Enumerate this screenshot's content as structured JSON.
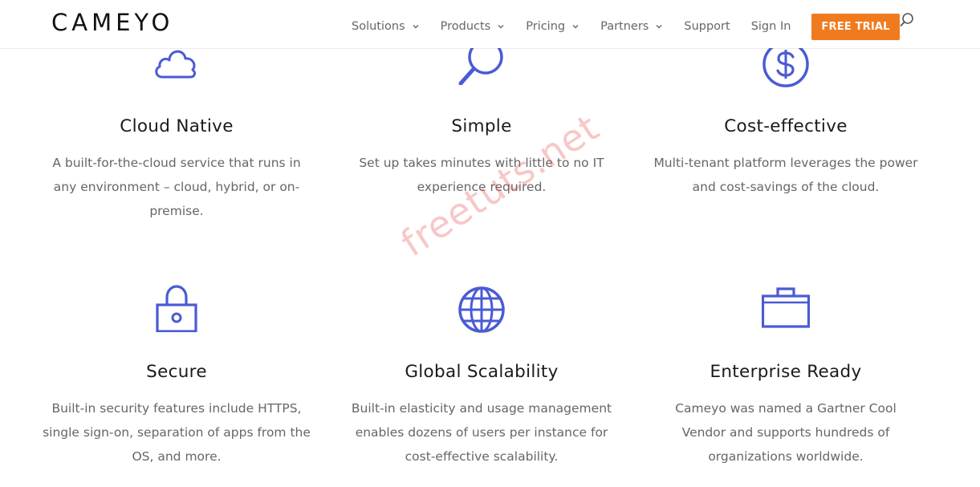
{
  "header": {
    "logo": "CAMEYO",
    "nav": [
      {
        "label": "Solutions",
        "has_dropdown": true
      },
      {
        "label": "Products",
        "has_dropdown": true
      },
      {
        "label": "Pricing",
        "has_dropdown": true
      },
      {
        "label": "Partners",
        "has_dropdown": true
      },
      {
        "label": "Support",
        "has_dropdown": false
      },
      {
        "label": "Sign In",
        "has_dropdown": false
      }
    ],
    "cta": "FREE TRIAL",
    "search_icon": "search-icon"
  },
  "features": [
    {
      "icon": "cloud-icon",
      "title": "Cloud Native",
      "desc_lines": [
        "A built-for-the-cloud service that runs in",
        "any environment – cloud, hybrid, or on-",
        "premise."
      ]
    },
    {
      "icon": "magnifier-icon",
      "title": "Simple",
      "desc_lines": [
        "Set up takes minutes with little to no IT",
        "experience required."
      ]
    },
    {
      "icon": "dollar-icon",
      "title": "Cost-effective",
      "desc_lines": [
        "Multi-tenant platform leverages the power",
        "and cost-savings of the cloud."
      ]
    },
    {
      "icon": "lock-icon",
      "title": "Secure",
      "desc_lines": [
        "Built-in security features include HTTPS,",
        "single sign-on, separation of apps from the",
        "OS, and more."
      ]
    },
    {
      "icon": "globe-icon",
      "title": "Global Scalability",
      "desc_lines": [
        "Built-in elasticity and usage management",
        "enables dozens of users per instance for",
        "cost-effective scalability."
      ]
    },
    {
      "icon": "briefcase-icon",
      "title": "Enterprise Ready",
      "desc_lines": [
        "Cameyo was named a Gartner Cool",
        "Vendor and supports hundreds of",
        "organizations worldwide."
      ]
    }
  ],
  "watermark": "freetuts.net",
  "colors": {
    "accent": "#4a5bd4",
    "cta": "#f07b1f",
    "text_dark": "#1a1a1a",
    "text_muted": "#666666"
  }
}
